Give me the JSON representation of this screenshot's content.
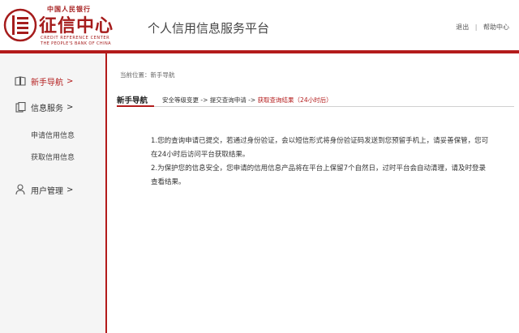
{
  "header": {
    "logo_top": "中国人民银行",
    "logo_main": "征信中心",
    "logo_en_line1": "CREDIT REFERENCE CENTER",
    "logo_en_line2": "THE PEOPLE'S BANK OF CHINA",
    "platform_title": "个人信用信息服务平台",
    "logout_label": "退出",
    "separator": "|",
    "help_label": "帮助中心"
  },
  "sidebar": {
    "items": [
      {
        "label": "新手导航",
        "arrow": ">",
        "icon": "book-icon",
        "active": true
      },
      {
        "label": "信息服务",
        "arrow": ">",
        "icon": "document-icon",
        "active": false
      },
      {
        "label": "用户管理",
        "arrow": ">",
        "icon": "user-icon",
        "active": false
      }
    ],
    "sub_items": [
      {
        "label": "申请信用信息"
      },
      {
        "label": "获取信用信息"
      }
    ]
  },
  "main": {
    "breadcrumb": "当前位置：新手导航",
    "section_title": "新手导航",
    "steps": {
      "step1": "安全等级变更",
      "arrow1": "->",
      "step2": "提交查询申请",
      "arrow2": "->",
      "step3": "获取查询结果（24小时后）"
    },
    "notice": [
      "1.您的查询申请已提交，若通过身份验证，会以短信形式将身份验证码发送到您预留手机上，请妥善保管，您可在24小时后访问平台获取结果。",
      "2.为保护您的信息安全，您申请的信用信息产品将在平台上保留7个自然日，过时平台会自动清理，请及时登录查看结果。"
    ]
  },
  "colors": {
    "brand_red": "#b31b1b",
    "sidebar_bg": "#f5f5f5"
  }
}
